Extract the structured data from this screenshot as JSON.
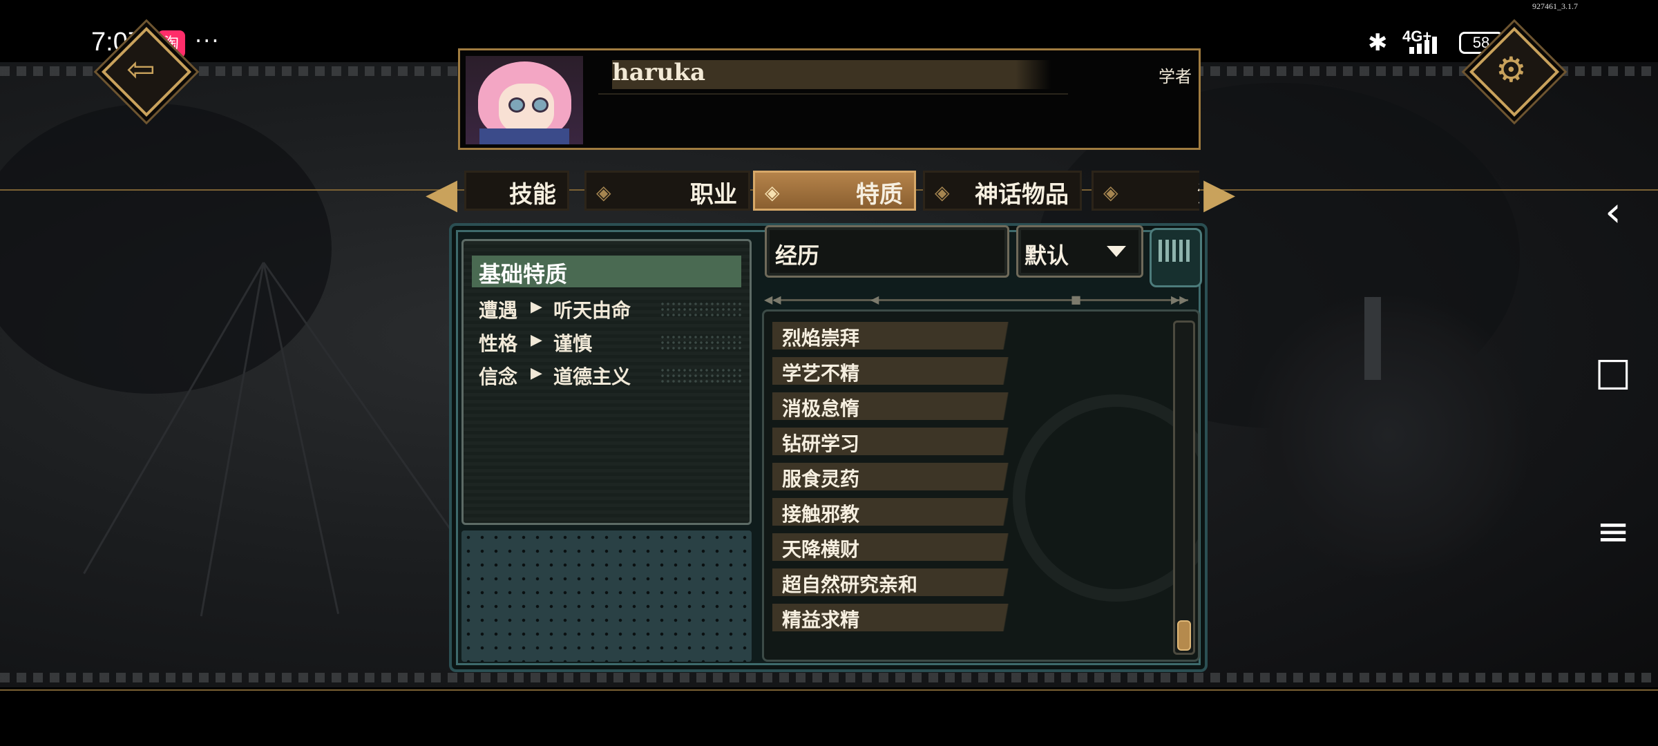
{
  "status_bar": {
    "time": "7:07",
    "taobao_glyph": "淘",
    "more": "···",
    "network": "4G+",
    "battery": "58",
    "build": "927461_3.1.7"
  },
  "profile": {
    "name": "haruka",
    "class": "学者"
  },
  "tabs": [
    {
      "label": "技能",
      "active": false
    },
    {
      "label": "职业",
      "active": false
    },
    {
      "label": "特质",
      "active": true
    },
    {
      "label": "神话物品",
      "active": false
    },
    {
      "label": "法",
      "active": false
    }
  ],
  "basic_traits": {
    "title": "基础特质",
    "rows": [
      {
        "key": "遭遇",
        "value": "听天由命"
      },
      {
        "key": "性格",
        "value": "谨慎"
      },
      {
        "key": "信念",
        "value": "道德主义"
      }
    ]
  },
  "search": {
    "value": "经历"
  },
  "sort": {
    "selected": "默认"
  },
  "trait_list": [
    "烈焰崇拜",
    "学艺不精",
    "消极怠惰",
    "钻研学习",
    "服食灵药",
    "接触邪教",
    "天降横财",
    "超自然研究亲和",
    "精益求精"
  ],
  "icons": {
    "back": "back-arrow-icon",
    "settings": "gear-icon",
    "nav_back": "‹",
    "nav_home": "□",
    "nav_menu": "≡"
  },
  "colors": {
    "accent_gold": "#c9a25c",
    "active_tab": "#b5834a",
    "section_green": "#4a6a52",
    "panel_teal": "#2b4f53"
  }
}
